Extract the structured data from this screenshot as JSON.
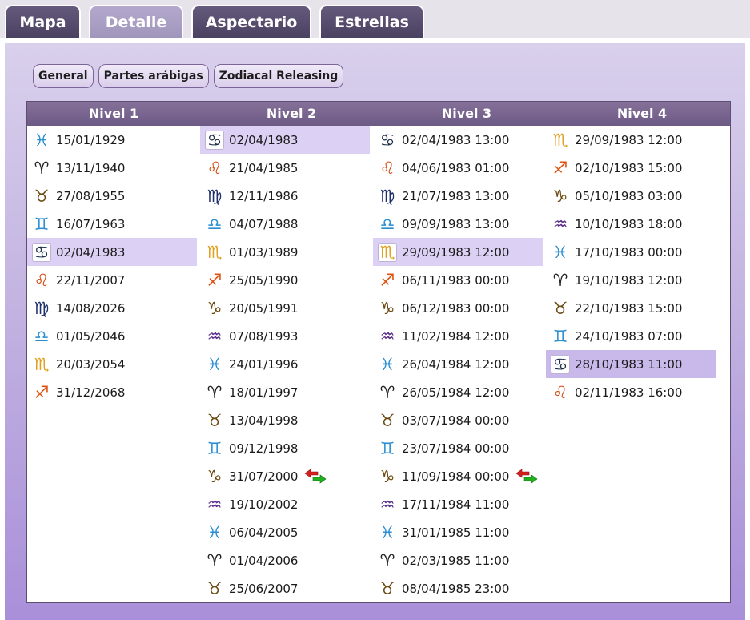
{
  "tabs": [
    "Mapa",
    "Detalle",
    "Aspectario",
    "Estrellas"
  ],
  "subtabs": [
    "General",
    "Partes arábigas",
    "Zodiacal Releasing"
  ],
  "columns": [
    {
      "header": "Nivel 1",
      "rows": [
        {
          "sign": "pisces",
          "glyph": "♓",
          "color": "#2a8ed0",
          "date": "15/01/1929"
        },
        {
          "sign": "aries",
          "glyph": "♈",
          "color": "#222222",
          "date": "13/11/1940"
        },
        {
          "sign": "taurus",
          "glyph": "♉",
          "color": "#6b4a12",
          "date": "27/08/1955"
        },
        {
          "sign": "gemini",
          "glyph": "♊",
          "color": "#2a8ed0",
          "date": "16/07/1963"
        },
        {
          "sign": "cancer",
          "glyph": "♋",
          "color": "#1f2f4a",
          "date": "02/04/1983",
          "selected": true
        },
        {
          "sign": "leo",
          "glyph": "♌",
          "color": "#d04a10",
          "date": "22/11/2007"
        },
        {
          "sign": "virgo",
          "glyph": "♍",
          "color": "#1f2f6a",
          "date": "14/08/2026"
        },
        {
          "sign": "libra",
          "glyph": "♎",
          "color": "#2a8ed0",
          "date": "01/05/2046"
        },
        {
          "sign": "scorpio",
          "glyph": "♏",
          "color": "#e0a020",
          "date": "20/03/2054"
        },
        {
          "sign": "sagittarius",
          "glyph": "♐",
          "color": "#e05010",
          "date": "31/12/2068"
        }
      ]
    },
    {
      "header": "Nivel 2",
      "rows": [
        {
          "sign": "cancer",
          "glyph": "♋",
          "color": "#1f2f4a",
          "date": "02/04/1983",
          "selected": true
        },
        {
          "sign": "leo",
          "glyph": "♌",
          "color": "#d04a10",
          "date": "21/04/1985"
        },
        {
          "sign": "virgo",
          "glyph": "♍",
          "color": "#1f2f6a",
          "date": "12/11/1986"
        },
        {
          "sign": "libra",
          "glyph": "♎",
          "color": "#2a8ed0",
          "date": "04/07/1988"
        },
        {
          "sign": "scorpio",
          "glyph": "♏",
          "color": "#e0a020",
          "date": "01/03/1989"
        },
        {
          "sign": "sagittarius",
          "glyph": "♐",
          "color": "#e05010",
          "date": "25/05/1990"
        },
        {
          "sign": "capricorn",
          "glyph": "♑",
          "color": "#6b4a12",
          "date": "20/05/1991"
        },
        {
          "sign": "aquarius",
          "glyph": "♒",
          "color": "#5a2f8a",
          "date": "07/08/1993"
        },
        {
          "sign": "pisces",
          "glyph": "♓",
          "color": "#2a8ed0",
          "date": "24/01/1996"
        },
        {
          "sign": "aries",
          "glyph": "♈",
          "color": "#222222",
          "date": "18/01/1997"
        },
        {
          "sign": "taurus",
          "glyph": "♉",
          "color": "#6b4a12",
          "date": "13/04/1998"
        },
        {
          "sign": "gemini",
          "glyph": "♊",
          "color": "#2a8ed0",
          "date": "09/12/1998"
        },
        {
          "sign": "capricorn",
          "glyph": "♑",
          "color": "#6b4a12",
          "date": "31/07/2000",
          "swap": true
        },
        {
          "sign": "aquarius",
          "glyph": "♒",
          "color": "#5a2f8a",
          "date": "19/10/2002"
        },
        {
          "sign": "pisces",
          "glyph": "♓",
          "color": "#2a8ed0",
          "date": "06/04/2005"
        },
        {
          "sign": "aries",
          "glyph": "♈",
          "color": "#222222",
          "date": "01/04/2006"
        },
        {
          "sign": "taurus",
          "glyph": "♉",
          "color": "#6b4a12",
          "date": "25/06/2007"
        }
      ]
    },
    {
      "header": "Nivel 3",
      "rows": [
        {
          "sign": "cancer",
          "glyph": "♋",
          "color": "#1f2f4a",
          "date": "02/04/1983 13:00"
        },
        {
          "sign": "leo",
          "glyph": "♌",
          "color": "#d04a10",
          "date": "04/06/1983 01:00"
        },
        {
          "sign": "virgo",
          "glyph": "♍",
          "color": "#1f2f6a",
          "date": "21/07/1983 13:00"
        },
        {
          "sign": "libra",
          "glyph": "♎",
          "color": "#2a8ed0",
          "date": "09/09/1983 13:00"
        },
        {
          "sign": "scorpio",
          "glyph": "♏",
          "color": "#e0a020",
          "date": "29/09/1983 12:00",
          "selected": true
        },
        {
          "sign": "sagittarius",
          "glyph": "♐",
          "color": "#e05010",
          "date": "06/11/1983 00:00"
        },
        {
          "sign": "capricorn",
          "glyph": "♑",
          "color": "#6b4a12",
          "date": "06/12/1983 00:00"
        },
        {
          "sign": "aquarius",
          "glyph": "♒",
          "color": "#5a2f8a",
          "date": "11/02/1984 12:00"
        },
        {
          "sign": "pisces",
          "glyph": "♓",
          "color": "#2a8ed0",
          "date": "26/04/1984 12:00"
        },
        {
          "sign": "aries",
          "glyph": "♈",
          "color": "#222222",
          "date": "26/05/1984 12:00"
        },
        {
          "sign": "taurus",
          "glyph": "♉",
          "color": "#6b4a12",
          "date": "03/07/1984 00:00"
        },
        {
          "sign": "gemini",
          "glyph": "♊",
          "color": "#2a8ed0",
          "date": "23/07/1984 00:00"
        },
        {
          "sign": "capricorn",
          "glyph": "♑",
          "color": "#6b4a12",
          "date": "11/09/1984 00:00",
          "swap": true
        },
        {
          "sign": "aquarius",
          "glyph": "♒",
          "color": "#5a2f8a",
          "date": "17/11/1984 11:00"
        },
        {
          "sign": "pisces",
          "glyph": "♓",
          "color": "#2a8ed0",
          "date": "31/01/1985 11:00"
        },
        {
          "sign": "aries",
          "glyph": "♈",
          "color": "#222222",
          "date": "02/03/1985 11:00"
        },
        {
          "sign": "taurus",
          "glyph": "♉",
          "color": "#6b4a12",
          "date": "08/04/1985 23:00"
        }
      ]
    },
    {
      "header": "Nivel 4",
      "rows": [
        {
          "sign": "scorpio",
          "glyph": "♏",
          "color": "#e0a020",
          "date": "29/09/1983 12:00"
        },
        {
          "sign": "sagittarius",
          "glyph": "♐",
          "color": "#e05010",
          "date": "02/10/1983 15:00"
        },
        {
          "sign": "capricorn",
          "glyph": "♑",
          "color": "#6b4a12",
          "date": "05/10/1983 03:00"
        },
        {
          "sign": "aquarius",
          "glyph": "♒",
          "color": "#5a2f8a",
          "date": "10/10/1983 18:00"
        },
        {
          "sign": "pisces",
          "glyph": "♓",
          "color": "#2a8ed0",
          "date": "17/10/1983 00:00"
        },
        {
          "sign": "aries",
          "glyph": "♈",
          "color": "#222222",
          "date": "19/10/1983 12:00"
        },
        {
          "sign": "taurus",
          "glyph": "♉",
          "color": "#6b4a12",
          "date": "22/10/1983 15:00"
        },
        {
          "sign": "gemini",
          "glyph": "♊",
          "color": "#2a8ed0",
          "date": "24/10/1983 07:00"
        },
        {
          "sign": "cancer",
          "glyph": "♋",
          "color": "#1f2f4a",
          "date": "28/10/1983 11:00",
          "selected": true
        },
        {
          "sign": "leo",
          "glyph": "♌",
          "color": "#d04a10",
          "date": "02/11/1983 16:00"
        }
      ]
    }
  ]
}
